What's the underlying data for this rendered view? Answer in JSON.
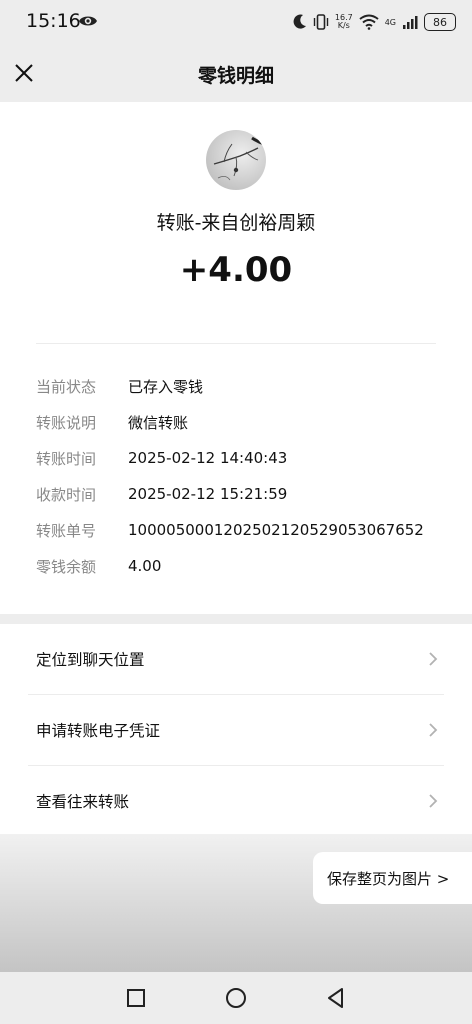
{
  "status_bar": {
    "time": "15:16",
    "speed_value": "16.7",
    "speed_unit": "K/s",
    "network": "4G",
    "battery": "86"
  },
  "nav": {
    "title": "零钱明细"
  },
  "detail": {
    "transfer_title": "转账-来自创裕周颖",
    "amount": "+4.00",
    "rows": [
      {
        "label": "当前状态",
        "value": "已存入零钱"
      },
      {
        "label": "转账说明",
        "value": "微信转账"
      },
      {
        "label": "转账时间",
        "value": "2025-02-12 14:40:43"
      },
      {
        "label": "收款时间",
        "value": "2025-02-12 15:21:59"
      },
      {
        "label": "转账单号",
        "value": "1000050001202502120529053067652"
      },
      {
        "label": "零钱余额",
        "value": "4.00"
      }
    ]
  },
  "actions": [
    {
      "label": "定位到聊天位置"
    },
    {
      "label": "申请转账电子凭证"
    },
    {
      "label": "查看往来转账"
    }
  ],
  "save_button": "保存整页为图片 >"
}
